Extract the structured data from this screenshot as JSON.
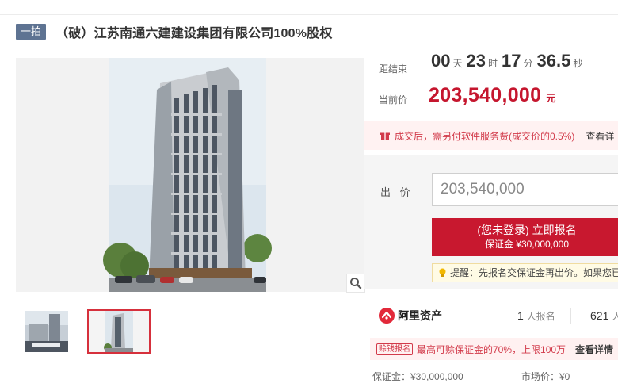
{
  "header": {
    "tag": "一拍",
    "title": "（破）江苏南通六建建设集团有限公司100%股权"
  },
  "countdown": {
    "label": "距结束",
    "days": "00",
    "days_unit": "天",
    "hours": "23",
    "hours_unit": "时",
    "minutes": "17",
    "minutes_unit": "分",
    "seconds": "36.5",
    "seconds_unit": "秒"
  },
  "current_price": {
    "label": "当前价",
    "value": "203,540,000",
    "unit": "元"
  },
  "fee_notice": {
    "text": "成交后，需另付软件服务费(成交价的0.5%)",
    "link": "查看详"
  },
  "bid": {
    "label": "出 价",
    "input_value": "203,540,000",
    "button_line1": "(您未登录) 立即报名",
    "button_line2": "保证金 ¥30,000,000",
    "reminder": "提醒：先报名交保证金再出价。如果您已"
  },
  "platform": {
    "name": "阿里资产",
    "signup_count": "1",
    "signup_label": "人报名",
    "views_count": "621",
    "views_label": "人"
  },
  "loan": {
    "tag": "赊钱报名",
    "text": "最高可赊保证金的70%，上限100万",
    "link": "查看详情"
  },
  "info": {
    "deposit": "保证金：¥30,000,000",
    "market_price": "市场价：¥0"
  },
  "icons": {
    "zoom": "magnifier-icon",
    "fee": "gift-icon",
    "reminder": "bulb-icon",
    "platform_logo": "ali-assets-logo-icon"
  },
  "colors": {
    "accent_red": "#c8182f",
    "price_red": "#c5162e",
    "tag_blue": "#5e7392"
  }
}
